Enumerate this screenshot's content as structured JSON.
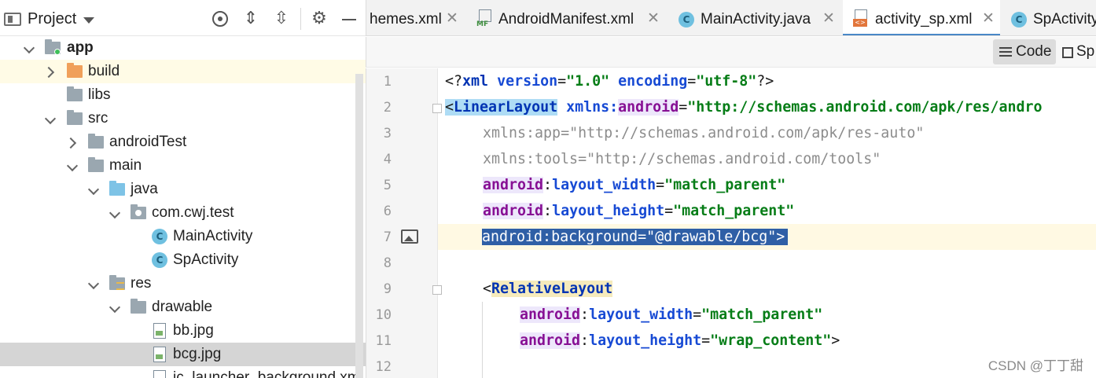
{
  "project_panel": {
    "title": "Project"
  },
  "tree": [
    {
      "label": "app"
    },
    {
      "label": "build"
    },
    {
      "label": "libs"
    },
    {
      "label": "src"
    },
    {
      "label": "androidTest"
    },
    {
      "label": "main"
    },
    {
      "label": "java"
    },
    {
      "label": "com.cwj.test"
    },
    {
      "label": "MainActivity"
    },
    {
      "label": "SpActivity"
    },
    {
      "label": "res"
    },
    {
      "label": "drawable"
    },
    {
      "label": "bb.jpg"
    },
    {
      "label": "bcg.jpg"
    },
    {
      "label": "ic_launcher_background.xml"
    }
  ],
  "tabs": [
    {
      "label": "hemes.xml"
    },
    {
      "label": "AndroidManifest.xml"
    },
    {
      "label": "MainActivity.java"
    },
    {
      "label": "activity_sp.xml"
    },
    {
      "label": "SpActivity"
    }
  ],
  "tab_close_glyph": "✕",
  "icons": {
    "class_letter": "C",
    "manifest_badge": "MF",
    "xml_badge": "<>"
  },
  "toolbar": {
    "code_label": "Code",
    "split_label": "Sp"
  },
  "gutter": {
    "line_numbers": [
      "1",
      "2",
      "3",
      "4",
      "5",
      "6",
      "7",
      "8",
      "9",
      "10",
      "11",
      "12"
    ]
  },
  "code": {
    "l1": {
      "open": "<?",
      "kw": "xml",
      "sp1": " ",
      "a1": "version",
      "eq1": "=",
      "v1": "\"1.0\"",
      "sp2": " ",
      "a2": "encoding",
      "eq2": "=",
      "v2": "\"utf-8\"",
      "close": "?>"
    },
    "l2": {
      "open": "<",
      "tag": "LinearLayout",
      "sp": " ",
      "xmlns": "xmlns:",
      "ns": "android",
      "eq": "=",
      "val": "\"http://schemas.android.com/apk/res/andro"
    },
    "l3": {
      "attr": "xmlns:app",
      "eq": "=",
      "val": "\"http://schemas.android.com/apk/res-auto\""
    },
    "l4": {
      "attr": "xmlns:tools",
      "eq": "=",
      "val": "\"http://schemas.android.com/tools\""
    },
    "l5": {
      "ns": "android",
      "colon": ":",
      "attr": "layout_width",
      "eq": "=",
      "val": "\"match_parent\""
    },
    "l6": {
      "ns": "android",
      "colon": ":",
      "attr": "layout_height",
      "eq": "=",
      "val": "\"match_parent\""
    },
    "l7": {
      "ns": "android",
      "colon": ":",
      "attr": "background",
      "eq": "=",
      "val": "\"@drawable/bcg\"",
      "close": ">"
    },
    "l9": {
      "open": "<",
      "tag": "RelativeLayout"
    },
    "l10": {
      "ns": "android",
      "colon": ":",
      "attr": "layout_width",
      "eq": "=",
      "val": "\"match_parent\""
    },
    "l11": {
      "ns": "android",
      "colon": ":",
      "attr": "layout_height",
      "eq": "=",
      "val": "\"wrap_content\"",
      "close": ">"
    }
  },
  "watermark": "CSDN @丁丁甜",
  "colors": {
    "tab_active_underline": "#4a88c7",
    "selection": "#2f5fa6",
    "xml_value": "#067d17",
    "xml_tag": "#0033b3",
    "namespace": "#871094"
  }
}
